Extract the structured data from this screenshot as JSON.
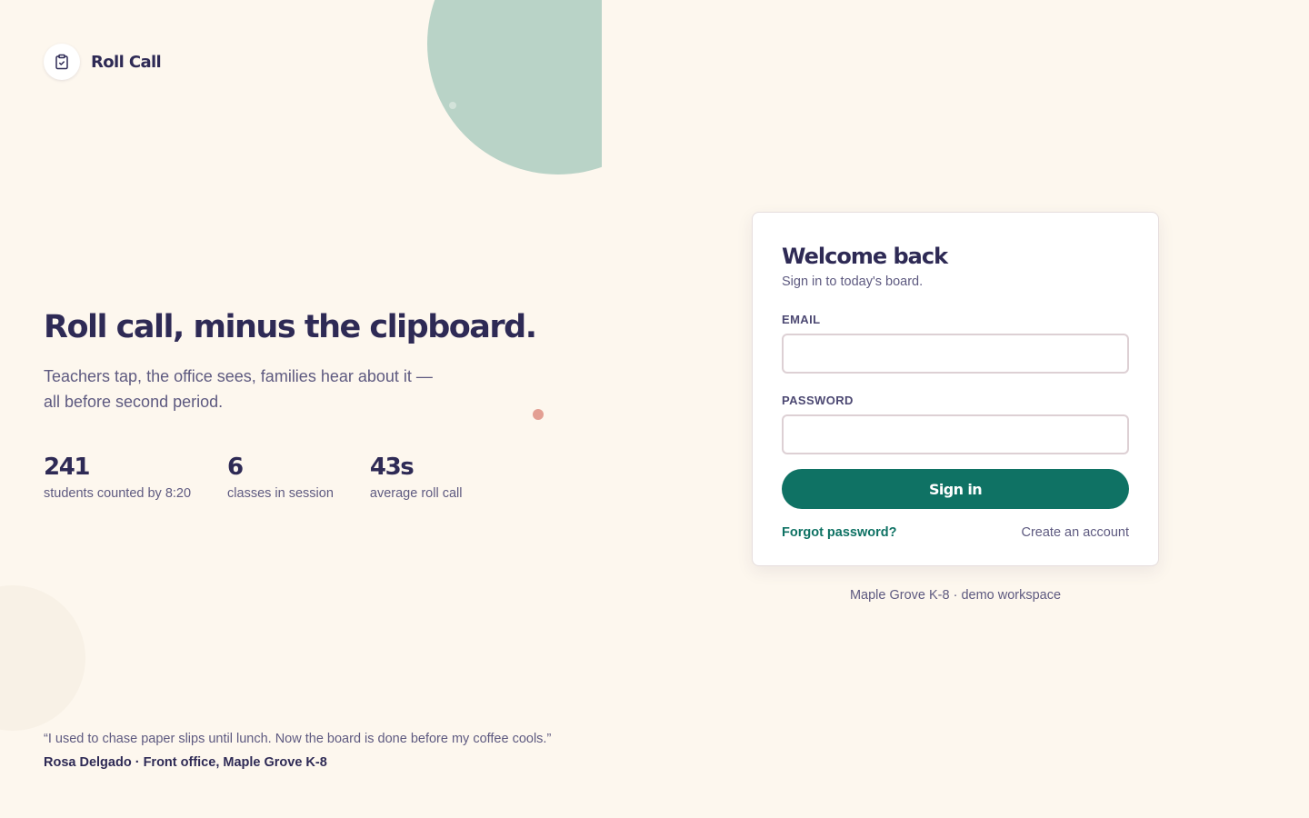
{
  "brand": {
    "name": "Roll Call",
    "icon": "clipboard-check-icon"
  },
  "hero": {
    "title": "Roll call, minus the clipboard.",
    "subtitle": "Teachers tap, the office sees, families hear about it — all before second period."
  },
  "stats": [
    {
      "value": "241",
      "label": "students counted by 8:20"
    },
    {
      "value": "6",
      "label": "classes in session"
    },
    {
      "value": "43s",
      "label": "average roll call"
    }
  ],
  "testimonial": {
    "quote": "“I used to chase paper slips until lunch. Now the board is done before my coffee cools.”",
    "author": "Rosa Delgado · Front office, Maple Grove K-8"
  },
  "login": {
    "title": "Welcome back",
    "subtitle": "Sign in to today's board.",
    "email_label": "EMAIL",
    "email_value": "",
    "password_label": "PASSWORD",
    "password_value": "",
    "submit_label": "Sign in",
    "forgot_label": "Forgot password?",
    "create_label": "Create an account"
  },
  "workspace_note": "Maple Grove K-8 · demo workspace",
  "colors": {
    "background": "#fdf7ee",
    "primary": "#0f7264",
    "ink": "#2e2a55",
    "muted": "#5e5a80",
    "blob_green": "#b9d3c7",
    "accent_coral": "#e39f93"
  }
}
